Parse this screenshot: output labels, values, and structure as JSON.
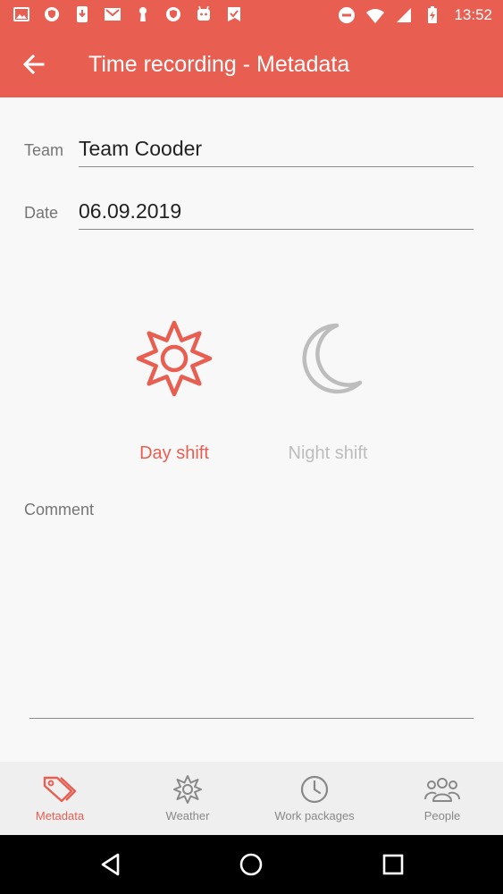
{
  "status_bar": {
    "time": "13:52",
    "left_icons": [
      "image-icon",
      "shield-icon",
      "download-icon",
      "mail-icon",
      "keyhole-icon",
      "shield-icon",
      "android-icon",
      "check-flag-icon"
    ],
    "right_icons": [
      "dnd-icon",
      "wifi-icon",
      "signal-icon",
      "battery-charging-icon"
    ]
  },
  "app_bar": {
    "title": "Time recording - Metadata",
    "back_icon": "arrow-left-icon"
  },
  "form": {
    "team_label": "Team",
    "team_value": "Team Cooder",
    "date_label": "Date",
    "date_value": "06.09.2019"
  },
  "shifts": {
    "day_label": "Day shift",
    "night_label": "Night shift",
    "selected": "day",
    "active_color": "#e85f52",
    "inactive_color": "#bdbdbd"
  },
  "comment": {
    "label": "Comment",
    "value": ""
  },
  "bottom_nav": {
    "items": [
      {
        "label": "Metadata",
        "icon": "tag-icon",
        "active": true
      },
      {
        "label": "Weather",
        "icon": "gear-icon",
        "active": false
      },
      {
        "label": "Work packages",
        "icon": "clock-icon",
        "active": false
      },
      {
        "label": "People",
        "icon": "people-icon",
        "active": false
      }
    ]
  },
  "colors": {
    "accent": "#e85f52",
    "background": "#f8f8f8",
    "nav_background": "#efefef"
  }
}
